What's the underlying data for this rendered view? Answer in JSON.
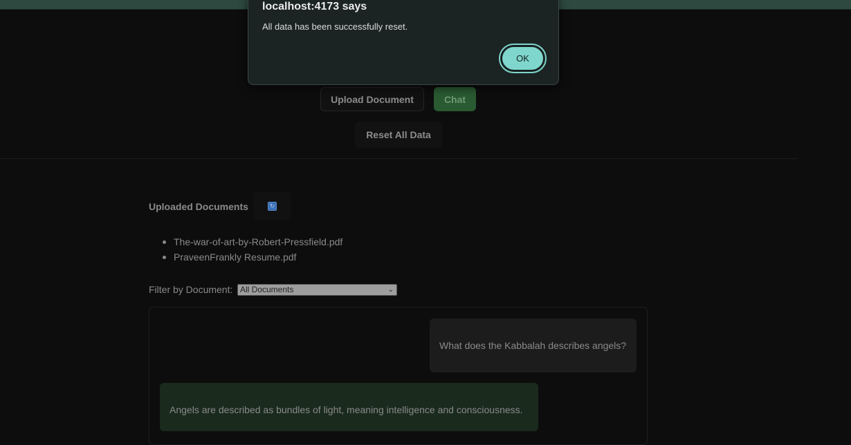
{
  "header": {
    "upload_label": "Upload Document",
    "chat_label": "Chat",
    "reset_label": "Reset All Data"
  },
  "documents": {
    "title": "Uploaded Documents",
    "refresh_icon_glyph": "↻",
    "items": [
      "The-war-of-art-by-Robert-Pressfield.pdf",
      "PraveenFrankly Resume.pdf"
    ]
  },
  "filter": {
    "label": "Filter by Document:",
    "selected": "All Documents",
    "chevron": "⌄"
  },
  "chat": {
    "user_message": "What does the Kabbalah describes angels?",
    "bot_message": "Angels are described as bundles of light, meaning intelligence and consciousness."
  },
  "alert": {
    "title": "localhost:4173 says",
    "message": "All data has been successfully reset.",
    "ok_label": "OK"
  },
  "colors": {
    "background": "#0d0d0d",
    "accent": "#7fd6cc",
    "chat_button": "#2a5a32",
    "top_strip": "#2e4a40"
  }
}
